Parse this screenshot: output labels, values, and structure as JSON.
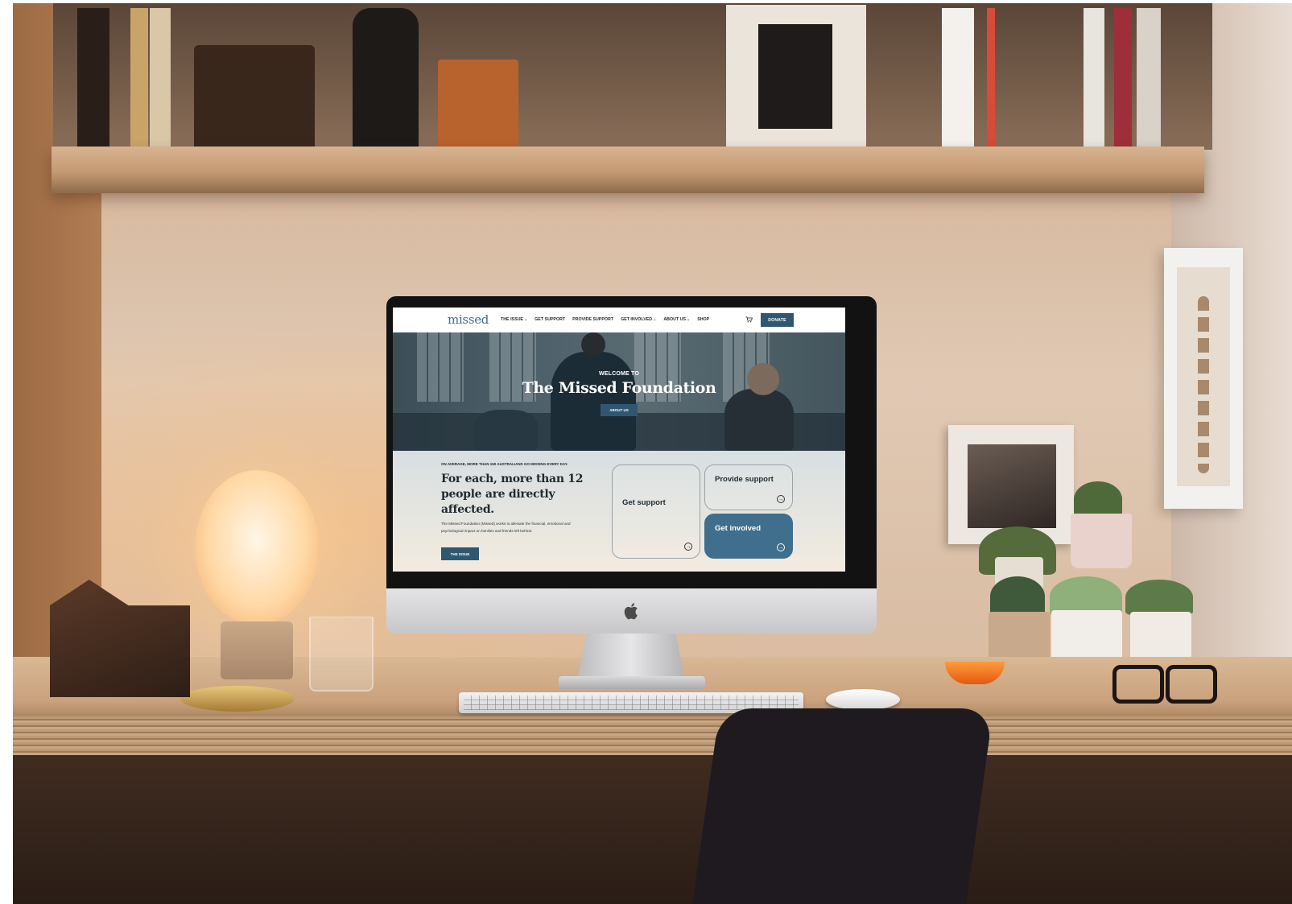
{
  "site": {
    "logo": "missed",
    "nav": [
      {
        "label": "THE ISSUE",
        "has_dropdown": true
      },
      {
        "label": "GET SUPPORT",
        "has_dropdown": false
      },
      {
        "label": "PROVIDE SUPPORT",
        "has_dropdown": false
      },
      {
        "label": "GET INVOLVED",
        "has_dropdown": true
      },
      {
        "label": "ABOUT US",
        "has_dropdown": true
      },
      {
        "label": "SHOP",
        "has_dropdown": false
      }
    ],
    "cart_icon": "cart-icon",
    "donate_label": "DONATE",
    "hero": {
      "welcome": "WELCOME TO",
      "title": "The Missed Foundation",
      "button": "ABOUT US"
    },
    "info": {
      "kicker": "ON AVERAGE, MORE THAN 150 AUSTRALIANS GO MISSING EVERY DAY.",
      "headline": "For each, more than 12 people are directly affected.",
      "description": "The Missed Foundation (Missed) works to alleviate the financial, emotional and psychological impact on families and friends left behind.",
      "button": "THE ISSUE"
    },
    "cards": {
      "get_support": "Get support",
      "provide_support": "Provide support",
      "get_involved": "Get involved",
      "arrow_icon": "arrow-right-circle-icon"
    }
  },
  "colors": {
    "brand_blue": "#2f5870",
    "card_blue": "#3f6f8c",
    "logo_blue": "#3f6f8c"
  }
}
